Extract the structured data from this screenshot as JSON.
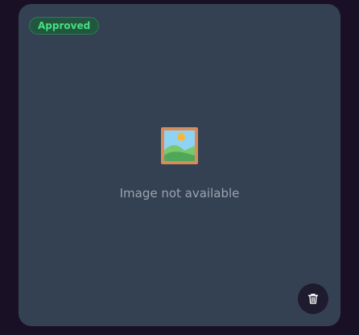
{
  "card": {
    "status_badge": "Approved",
    "placeholder_message": "Image not available",
    "placeholder_icon": "image-icon",
    "delete_icon": "trash-icon"
  },
  "colors": {
    "page_background": "#1a1025",
    "card_background": "#344153",
    "badge_text": "#4ade80",
    "badge_background": "#22573f",
    "message_text": "#9ca3af",
    "delete_button_background": "#1f1b2e"
  }
}
